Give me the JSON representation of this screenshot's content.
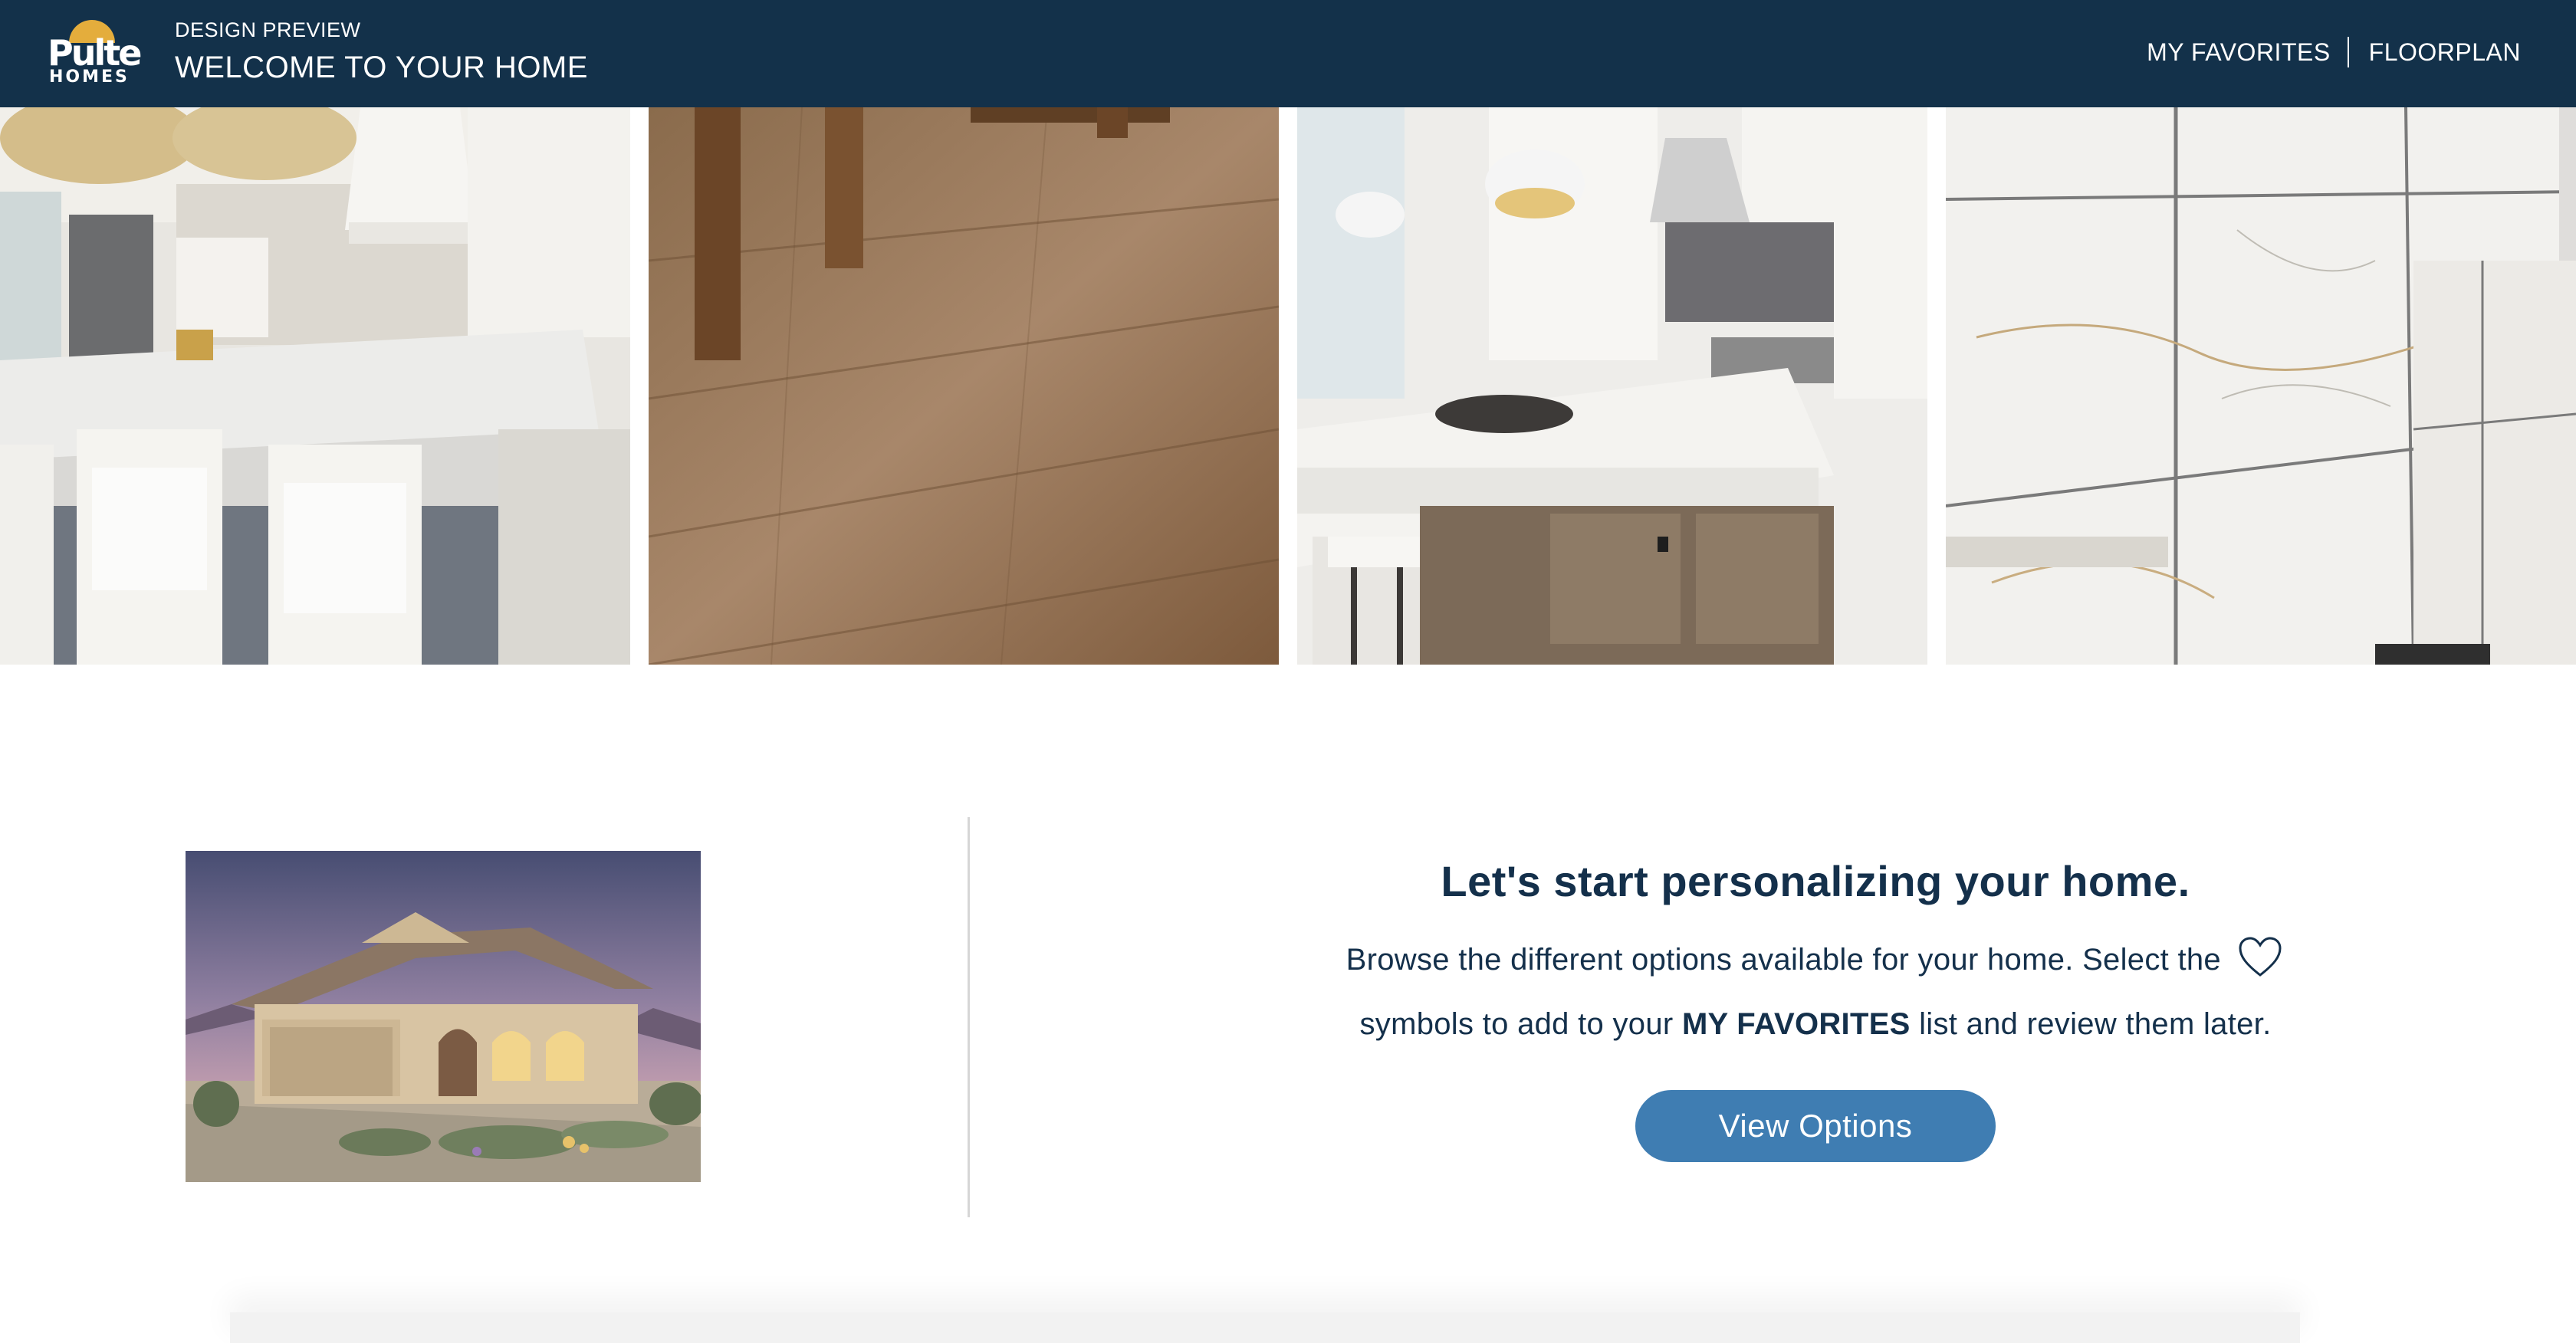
{
  "header": {
    "logo_line1": "Pulte",
    "logo_line2": "HOMES",
    "subtitle": "DESIGN PREVIEW",
    "title": "WELCOME TO YOUR HOME",
    "nav": {
      "favorites": "MY FAVORITES",
      "floorplan": "FLOORPLAN"
    }
  },
  "intro": {
    "heading": "Let's start personalizing your home.",
    "body_part1": "Browse the different options available for your home. Select the",
    "body_part2": "symbols to add to your",
    "body_bold": "MY FAVORITES",
    "body_part3": "list and review them later.",
    "button": "View Options"
  },
  "colors": {
    "header_bg": "#13314a",
    "text": "#14304b",
    "button": "#3f7db2"
  },
  "icons": {
    "heart": "heart-icon"
  }
}
